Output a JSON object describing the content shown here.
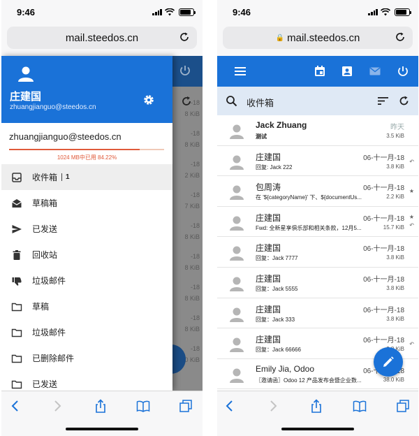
{
  "status": {
    "time": "9:46"
  },
  "left": {
    "url": "mail.steedos.cn",
    "drawer": {
      "name": "庄建国",
      "email": "zhuangjianguo@steedos.cn",
      "account": "zhuangjianguo@steedos.cn",
      "quota_text": "1024 MB中已用 84.22%",
      "quota_percent": 84.22,
      "items": [
        {
          "label": "收件箱",
          "count": "1",
          "icon": "inbox-icon"
        },
        {
          "label": "草稿箱",
          "icon": "drafts-icon"
        },
        {
          "label": "已发送",
          "icon": "send-icon"
        },
        {
          "label": "回收站",
          "icon": "trash-icon"
        },
        {
          "label": "垃圾邮件",
          "icon": "thumb-down-icon"
        },
        {
          "label": "草稿",
          "icon": "folder-icon"
        },
        {
          "label": "垃圾邮件",
          "icon": "folder-icon"
        },
        {
          "label": "已删除邮件",
          "icon": "folder-icon"
        },
        {
          "label": "已发送",
          "icon": "folder-icon"
        }
      ]
    },
    "background_dates": [
      "昨天",
      "-18",
      "-18",
      "-18",
      "-18",
      "-18",
      "-18",
      "-18",
      "-18",
      "-18"
    ],
    "background_sizes": [
      "",
      "8 KiB",
      "8 KiB",
      "2 KiB",
      "7 KiB",
      "8 KiB",
      "8 KiB",
      "8 KiB",
      "8 KiB",
      "0 KiB"
    ]
  },
  "right": {
    "url": "mail.steedos.cn",
    "folder_title": "收件箱",
    "emails": [
      {
        "from": "Jack Zhuang",
        "subject": "测试",
        "date": "昨天",
        "size": "3.5 KiB",
        "bold": true,
        "flag": ""
      },
      {
        "from": "庄建国",
        "subject": "回复: Jack 222",
        "date": "06-十一月-18",
        "size": "3.8 KiB",
        "bold": false,
        "flag": "reply"
      },
      {
        "from": "包周涛",
        "subject": "在 '${categoryName}' 下、${documentUs...",
        "date": "06-十一月-18",
        "size": "2.2 KiB",
        "bold": false,
        "flag": "star"
      },
      {
        "from": "庄建国",
        "subject": "Fwd: 全新星享俱乐部和相关条款，12月5...",
        "date": "06-十一月-18",
        "size": "15.7 KiB",
        "bold": false,
        "flag": "star-reply"
      },
      {
        "from": "庄建国",
        "subject": "回复：Jack 7777",
        "date": "06-十一月-18",
        "size": "3.8 KiB",
        "bold": false,
        "flag": ""
      },
      {
        "from": "庄建国",
        "subject": "回复：Jack 5555",
        "date": "06-十一月-18",
        "size": "3.8 KiB",
        "bold": false,
        "flag": ""
      },
      {
        "from": "庄建国",
        "subject": "回复：Jack 333",
        "date": "06-十一月-18",
        "size": "3.8 KiB",
        "bold": false,
        "flag": ""
      },
      {
        "from": "庄建国",
        "subject": "回复：Jack 66666",
        "date": "06-十一月-18",
        "size": "3.8 KiB",
        "bold": false,
        "flag": "reply"
      },
      {
        "from": "Emily Jia, Odoo",
        "subject": "〖邀请函〗Odoo 12 产品发布会暨企业数...",
        "date": "06-十一月-18",
        "size": "38.0 KiB",
        "bold": false,
        "flag": ""
      }
    ]
  },
  "colors": {
    "primary": "#1a72d8",
    "quota": "#e05a3a",
    "search_bg": "#dfe9f5"
  }
}
